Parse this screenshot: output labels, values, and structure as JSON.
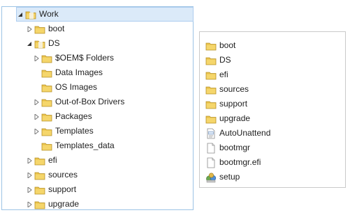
{
  "tree": {
    "items": [
      {
        "label": "Work",
        "expanded": true
      },
      {
        "label": "boot",
        "expanded": false
      },
      {
        "label": "DS",
        "expanded": true
      },
      {
        "label": "$OEM$ Folders",
        "expanded": false
      },
      {
        "label": "Data Images"
      },
      {
        "label": "OS Images"
      },
      {
        "label": "Out-of-Box Drivers",
        "expanded": false
      },
      {
        "label": "Packages",
        "expanded": false
      },
      {
        "label": "Templates",
        "expanded": false
      },
      {
        "label": "Templates_data"
      },
      {
        "label": "efi",
        "expanded": false
      },
      {
        "label": "sources",
        "expanded": false
      },
      {
        "label": "support",
        "expanded": false
      },
      {
        "label": "upgrade",
        "expanded": false
      }
    ]
  },
  "files": {
    "items": [
      {
        "label": "boot",
        "icon": "folder-icon"
      },
      {
        "label": "DS",
        "icon": "folder-icon"
      },
      {
        "label": "efi",
        "icon": "folder-icon"
      },
      {
        "label": "sources",
        "icon": "folder-icon"
      },
      {
        "label": "support",
        "icon": "folder-icon"
      },
      {
        "label": "upgrade",
        "icon": "folder-icon"
      },
      {
        "label": "AutoUnattend",
        "icon": "xml-file-icon"
      },
      {
        "label": "bootmgr",
        "icon": "file-icon"
      },
      {
        "label": "bootmgr.efi",
        "icon": "file-icon"
      },
      {
        "label": "setup",
        "icon": "setup-icon"
      }
    ]
  },
  "colors": {
    "folder": "#e9c24a",
    "selection": "#dbeaf9",
    "tree_border": "#9cc3e5"
  }
}
